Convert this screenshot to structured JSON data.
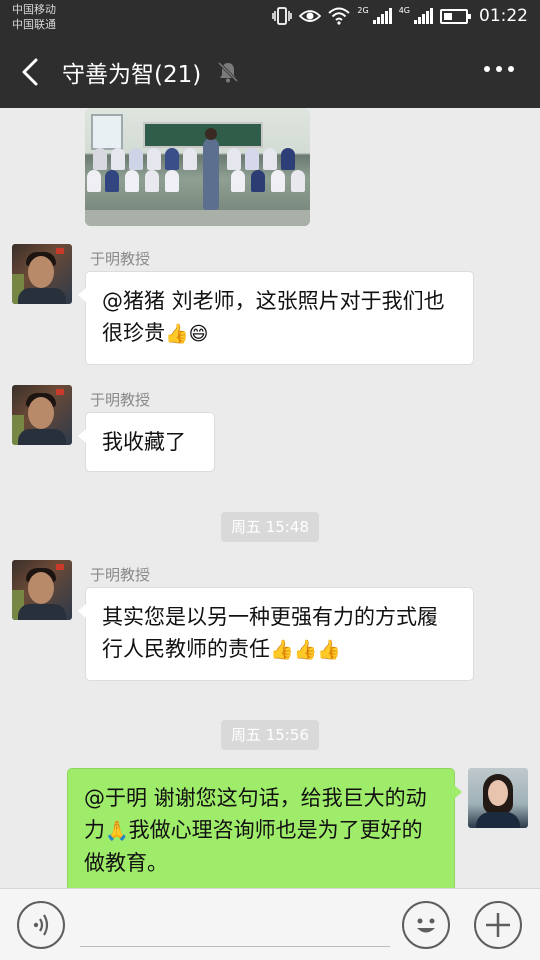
{
  "status_bar": {
    "carrier_1": "中国移动",
    "carrier_2": "中国联通",
    "network_1": "2G",
    "network_2": "4G",
    "time": "01:22"
  },
  "header": {
    "title": "守善为智(21)",
    "icons": [
      "back-arrow-icon",
      "mute-bell-icon",
      "more-dots-icon"
    ]
  },
  "messages": [
    {
      "type": "image",
      "sender": "",
      "description": "classroom-photo"
    },
    {
      "type": "text",
      "sender": "于明教授",
      "text": "@猪猪  刘老师，这张照片对于我们也很珍贵",
      "emojis": [
        "👍",
        "😄"
      ]
    },
    {
      "type": "text",
      "sender": "于明教授",
      "text": "我收藏了",
      "emojis": []
    },
    {
      "type": "time",
      "text": "周五 15:48"
    },
    {
      "type": "text",
      "sender": "于明教授",
      "text": "其实您是以另一种更强有力的方式履行人民教师的责任",
      "emojis": [
        "👍",
        "👍",
        "👍"
      ]
    },
    {
      "type": "time",
      "text": "周五 15:56"
    },
    {
      "type": "text",
      "sender": "me",
      "text_part1": "@于明  谢谢您这句话，给我巨大的动力",
      "emoji": "🙏",
      "text_part2": "我做心理咨询师也是为了更好的做教育。"
    }
  ],
  "input_bar": {
    "placeholder": "",
    "icons": [
      "voice-icon",
      "emoji-face-icon",
      "plus-icon"
    ]
  }
}
